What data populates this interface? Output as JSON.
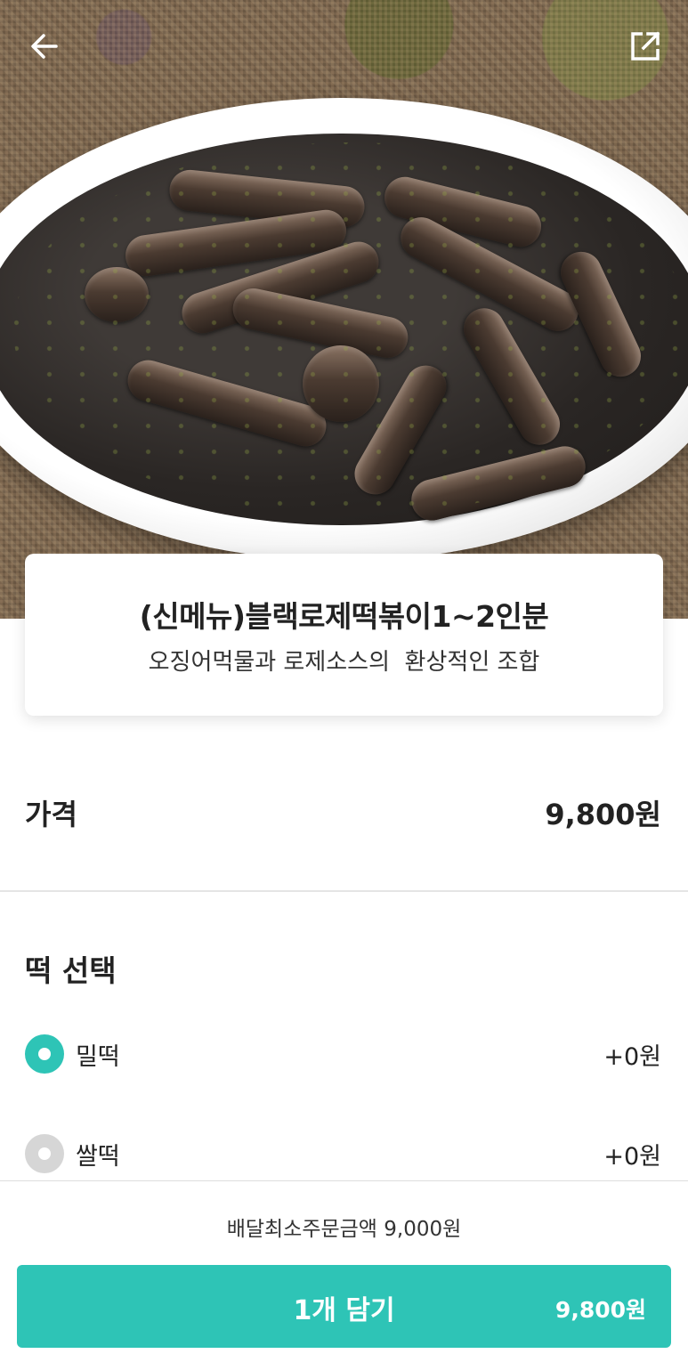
{
  "colors": {
    "accent": "#2ec4b6",
    "radio_unselected": "#d6d6d6"
  },
  "header": {
    "back_icon": "arrow-left-icon",
    "share_icon": "share-external-icon"
  },
  "menu": {
    "title": "(신메뉴)블랙로제떡볶이1~2인분",
    "description": "오징어먹물과 로제소스의  환상적인 조합"
  },
  "price": {
    "label": "가격",
    "value": "9,800원"
  },
  "options": {
    "title": "떡 선택",
    "items": [
      {
        "label": "밀떡",
        "price": "+0원",
        "selected": true
      },
      {
        "label": "쌀떡",
        "price": "+0원",
        "selected": false
      }
    ]
  },
  "bottom": {
    "min_order": "배달최소주문금액 9,000원",
    "add_button_label": "1개 담기",
    "add_button_price": "9,800원"
  }
}
